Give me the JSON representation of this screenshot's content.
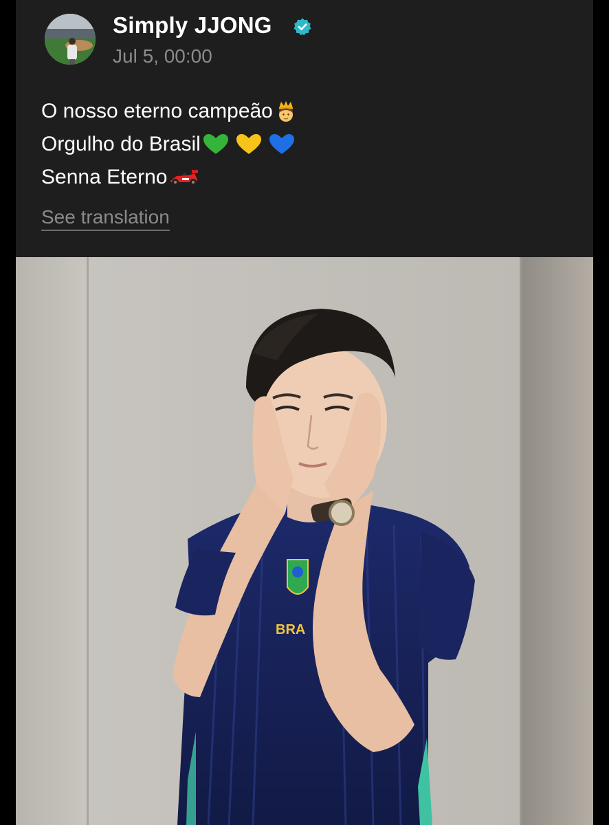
{
  "post": {
    "author": {
      "name": "Simply JJONG",
      "verified": true,
      "avatar_icon": "avatar-image"
    },
    "timestamp": "Jul 5, 00:00",
    "text_lines": [
      {
        "text": "O nosso eterno campeão",
        "emoji": "crowned-person"
      },
      {
        "text": "Orgulho do Brasil",
        "emoji": "green-yellow-blue-hearts"
      },
      {
        "text": "Senna Eterno",
        "emoji": "race-car"
      }
    ],
    "translate_label": "See translation",
    "photo": {
      "description_icon": "post-photo",
      "jersey_text": "BRA"
    }
  },
  "colors": {
    "card_bg": "#1e1e1e",
    "verified_badge": "#2fb8c9",
    "heart_green": "#35b43a",
    "heart_yellow": "#f7c21a",
    "heart_blue": "#1f6fe5"
  }
}
